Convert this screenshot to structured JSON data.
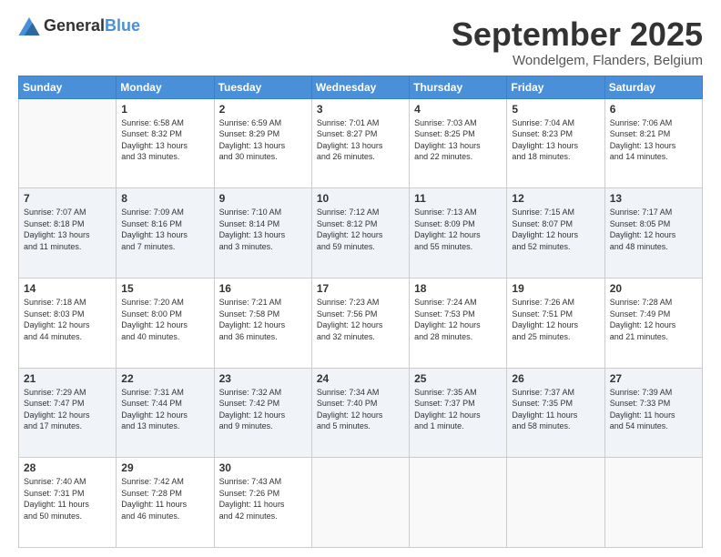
{
  "logo": {
    "text_general": "General",
    "text_blue": "Blue"
  },
  "title": "September 2025",
  "location": "Wondelgem, Flanders, Belgium",
  "weekdays": [
    "Sunday",
    "Monday",
    "Tuesday",
    "Wednesday",
    "Thursday",
    "Friday",
    "Saturday"
  ],
  "weeks": [
    [
      {
        "day": "",
        "info": ""
      },
      {
        "day": "1",
        "info": "Sunrise: 6:58 AM\nSunset: 8:32 PM\nDaylight: 13 hours\nand 33 minutes."
      },
      {
        "day": "2",
        "info": "Sunrise: 6:59 AM\nSunset: 8:29 PM\nDaylight: 13 hours\nand 30 minutes."
      },
      {
        "day": "3",
        "info": "Sunrise: 7:01 AM\nSunset: 8:27 PM\nDaylight: 13 hours\nand 26 minutes."
      },
      {
        "day": "4",
        "info": "Sunrise: 7:03 AM\nSunset: 8:25 PM\nDaylight: 13 hours\nand 22 minutes."
      },
      {
        "day": "5",
        "info": "Sunrise: 7:04 AM\nSunset: 8:23 PM\nDaylight: 13 hours\nand 18 minutes."
      },
      {
        "day": "6",
        "info": "Sunrise: 7:06 AM\nSunset: 8:21 PM\nDaylight: 13 hours\nand 14 minutes."
      }
    ],
    [
      {
        "day": "7",
        "info": "Sunrise: 7:07 AM\nSunset: 8:18 PM\nDaylight: 13 hours\nand 11 minutes."
      },
      {
        "day": "8",
        "info": "Sunrise: 7:09 AM\nSunset: 8:16 PM\nDaylight: 13 hours\nand 7 minutes."
      },
      {
        "day": "9",
        "info": "Sunrise: 7:10 AM\nSunset: 8:14 PM\nDaylight: 13 hours\nand 3 minutes."
      },
      {
        "day": "10",
        "info": "Sunrise: 7:12 AM\nSunset: 8:12 PM\nDaylight: 12 hours\nand 59 minutes."
      },
      {
        "day": "11",
        "info": "Sunrise: 7:13 AM\nSunset: 8:09 PM\nDaylight: 12 hours\nand 55 minutes."
      },
      {
        "day": "12",
        "info": "Sunrise: 7:15 AM\nSunset: 8:07 PM\nDaylight: 12 hours\nand 52 minutes."
      },
      {
        "day": "13",
        "info": "Sunrise: 7:17 AM\nSunset: 8:05 PM\nDaylight: 12 hours\nand 48 minutes."
      }
    ],
    [
      {
        "day": "14",
        "info": "Sunrise: 7:18 AM\nSunset: 8:03 PM\nDaylight: 12 hours\nand 44 minutes."
      },
      {
        "day": "15",
        "info": "Sunrise: 7:20 AM\nSunset: 8:00 PM\nDaylight: 12 hours\nand 40 minutes."
      },
      {
        "day": "16",
        "info": "Sunrise: 7:21 AM\nSunset: 7:58 PM\nDaylight: 12 hours\nand 36 minutes."
      },
      {
        "day": "17",
        "info": "Sunrise: 7:23 AM\nSunset: 7:56 PM\nDaylight: 12 hours\nand 32 minutes."
      },
      {
        "day": "18",
        "info": "Sunrise: 7:24 AM\nSunset: 7:53 PM\nDaylight: 12 hours\nand 28 minutes."
      },
      {
        "day": "19",
        "info": "Sunrise: 7:26 AM\nSunset: 7:51 PM\nDaylight: 12 hours\nand 25 minutes."
      },
      {
        "day": "20",
        "info": "Sunrise: 7:28 AM\nSunset: 7:49 PM\nDaylight: 12 hours\nand 21 minutes."
      }
    ],
    [
      {
        "day": "21",
        "info": "Sunrise: 7:29 AM\nSunset: 7:47 PM\nDaylight: 12 hours\nand 17 minutes."
      },
      {
        "day": "22",
        "info": "Sunrise: 7:31 AM\nSunset: 7:44 PM\nDaylight: 12 hours\nand 13 minutes."
      },
      {
        "day": "23",
        "info": "Sunrise: 7:32 AM\nSunset: 7:42 PM\nDaylight: 12 hours\nand 9 minutes."
      },
      {
        "day": "24",
        "info": "Sunrise: 7:34 AM\nSunset: 7:40 PM\nDaylight: 12 hours\nand 5 minutes."
      },
      {
        "day": "25",
        "info": "Sunrise: 7:35 AM\nSunset: 7:37 PM\nDaylight: 12 hours\nand 1 minute."
      },
      {
        "day": "26",
        "info": "Sunrise: 7:37 AM\nSunset: 7:35 PM\nDaylight: 11 hours\nand 58 minutes."
      },
      {
        "day": "27",
        "info": "Sunrise: 7:39 AM\nSunset: 7:33 PM\nDaylight: 11 hours\nand 54 minutes."
      }
    ],
    [
      {
        "day": "28",
        "info": "Sunrise: 7:40 AM\nSunset: 7:31 PM\nDaylight: 11 hours\nand 50 minutes."
      },
      {
        "day": "29",
        "info": "Sunrise: 7:42 AM\nSunset: 7:28 PM\nDaylight: 11 hours\nand 46 minutes."
      },
      {
        "day": "30",
        "info": "Sunrise: 7:43 AM\nSunset: 7:26 PM\nDaylight: 11 hours\nand 42 minutes."
      },
      {
        "day": "",
        "info": ""
      },
      {
        "day": "",
        "info": ""
      },
      {
        "day": "",
        "info": ""
      },
      {
        "day": "",
        "info": ""
      }
    ]
  ]
}
